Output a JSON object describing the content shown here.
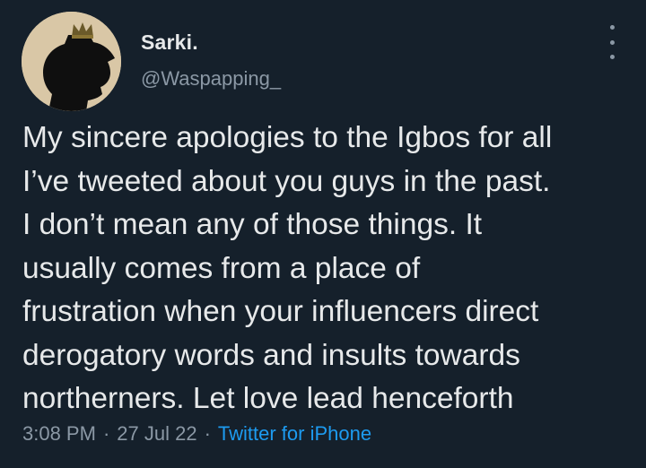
{
  "author": {
    "name": "Sarki.",
    "handle": "@Waspapping_"
  },
  "more_icon": "more-vertical-icon",
  "tweet": {
    "lines": [
      "My sincere apologies to the Igbos for all",
      "I’ve tweeted about you guys in the past.",
      "I don’t mean any of those things. It",
      "usually comes from a place of",
      "frustration when your influencers direct",
      "derogatory words and insults towards",
      "northerners. Let love lead henceforth"
    ]
  },
  "meta": {
    "time": "3:08 PM",
    "separator": "·",
    "date": "27 Jul 22",
    "source": "Twitter for iPhone"
  },
  "colors": {
    "background": "#15202b",
    "text": "#e7e9ea",
    "secondary": "#8b98a5",
    "accent": "#1d9bf0"
  }
}
